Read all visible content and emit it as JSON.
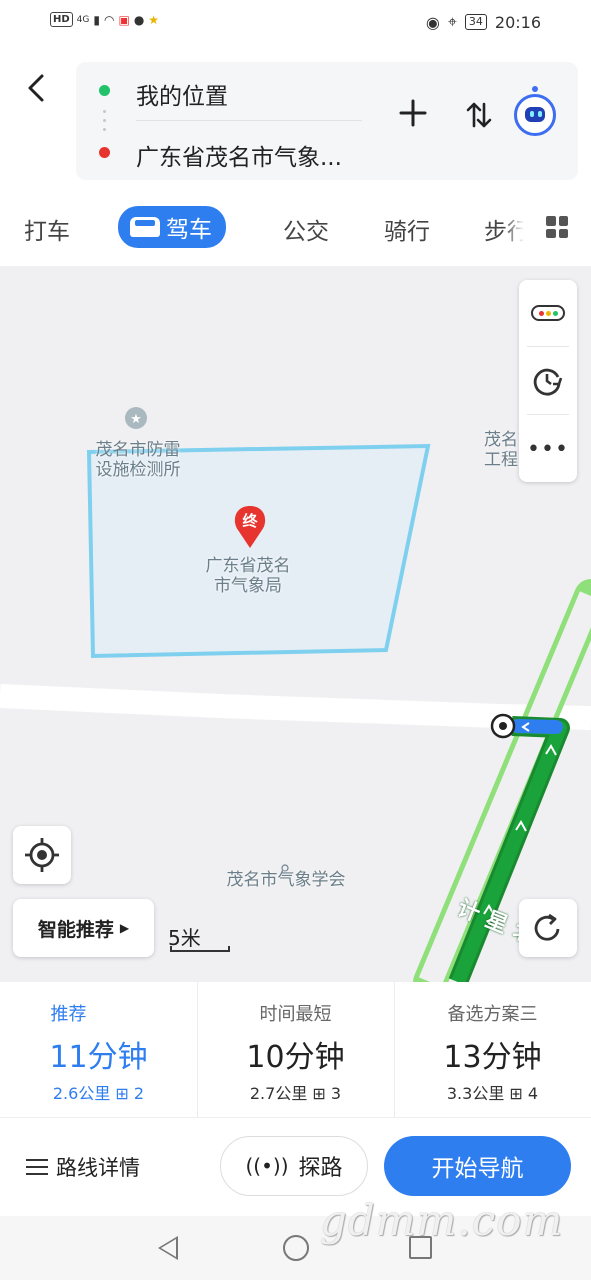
{
  "status_bar": {
    "left_badge": "HD",
    "signal_label": "4G",
    "time": "20:16",
    "battery": "34"
  },
  "header": {
    "from": "我的位置",
    "to": "广东省茂名市气象...",
    "icons": [
      "back-arrow-icon",
      "add-stop-icon",
      "swap-icon",
      "assistant-robot-icon"
    ]
  },
  "tabs": [
    {
      "label": "打车",
      "active": false
    },
    {
      "label": "驾车",
      "active": true
    },
    {
      "label": "公交",
      "active": false
    },
    {
      "label": "骑行",
      "active": false
    },
    {
      "label": "步行",
      "active": false
    }
  ],
  "map": {
    "labels": {
      "poi_1": "茂名市防雷\n设施检测所",
      "poi_2": "茂名市气\n工程",
      "destination": "广东省茂名\n市气象局",
      "society": "茂名市气象学会",
      "road": "计星北"
    },
    "end_marker": "终",
    "scale": "5米",
    "smart_recommend": "智能推荐"
  },
  "routes": [
    {
      "tag": "推荐",
      "time": "11分钟",
      "distance": "2.6公里",
      "lights": "2",
      "selected": true
    },
    {
      "tag": "时间最短",
      "time": "10分钟",
      "distance": "2.7公里",
      "lights": "3",
      "selected": false
    },
    {
      "tag": "备选方案三",
      "time": "13分钟",
      "distance": "3.3公里",
      "lights": "4",
      "selected": false
    }
  ],
  "actions": {
    "details": "路线详情",
    "probe": "探路",
    "start": "开始导航"
  },
  "watermark": "gdmm.com",
  "colors": {
    "accent": "#2f7ef0",
    "route_green": "#1aa33a",
    "route_light_green": "#8fe07a",
    "area_outline": "#7fd0ef",
    "origin_dot": "#22c26a",
    "dest_dot": "#e8342e"
  }
}
